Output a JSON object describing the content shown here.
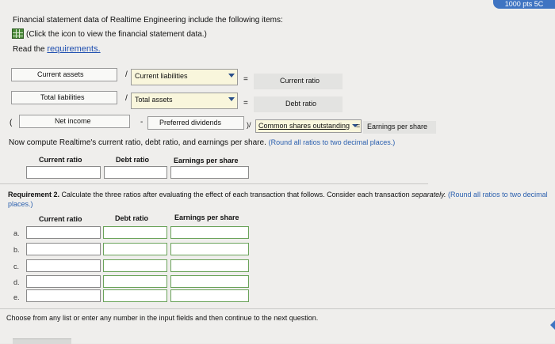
{
  "intro": {
    "line1": "Financial statement data of Realtime Engineering include the following items:",
    "line2": "(Click the icon to view the financial statement data.)",
    "read_prefix": "Read the ",
    "requirements_link": "requirements."
  },
  "formulas": {
    "current_ratio": {
      "numerator": "Current assets",
      "operator": "/",
      "denominator": "Current liabilities",
      "equals": "=",
      "result": "Current ratio"
    },
    "debt_ratio": {
      "numerator": "Total liabilities",
      "operator": "/",
      "denominator": "Total assets",
      "equals": "=",
      "result": "Debt ratio"
    },
    "eps": {
      "open_paren": "(",
      "term1": "Net income",
      "minus": "-",
      "term2": "Preferred dividends",
      "close_div": ")/",
      "denominator": "Common shares outstanding",
      "equals": "=",
      "result": "Earnings per share"
    }
  },
  "compute": {
    "instruction": "Now compute Realtime's current ratio, debt ratio, and earnings per share.",
    "note": "(Round all ratios to two decimal places.)",
    "headers": [
      "Current ratio",
      "Debt ratio",
      "Earnings per share"
    ]
  },
  "requirement2": {
    "label": "Requirement 2.",
    "text": "Calculate the three ratios after evaluating the effect of each transaction that follows. Consider each transaction",
    "separately": "separately.",
    "note": "(Round all ratios to two decimal",
    "note2": "places.)",
    "headers": [
      "Current ratio",
      "Debt ratio",
      "Earnings per share"
    ],
    "rows": [
      "a.",
      "b.",
      "c.",
      "d.",
      "e."
    ]
  },
  "footer": {
    "text": "Choose from any list or enter any number in the input fields and then continue to the next question."
  },
  "badge": {
    "text": "1000 pts 5C"
  },
  "colors": {
    "accent": "#3f74c2",
    "link": "#1f4fb0",
    "select_bg": "#f9f6dc",
    "icon_green": "#4b8a3a"
  }
}
